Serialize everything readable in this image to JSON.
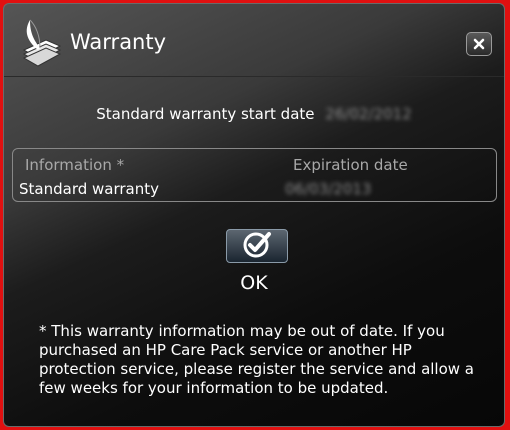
{
  "window": {
    "title": "Warranty",
    "close_icon": "close-icon",
    "app_icon": "warranty-feather-icon"
  },
  "start_date": {
    "label": "Standard warranty start date",
    "value": "26/02/2012"
  },
  "table": {
    "headers": [
      "Information *",
      "Expiration date"
    ],
    "rows": [
      {
        "information": "Standard warranty",
        "expiration": "06/03/2013"
      }
    ]
  },
  "ok_button": {
    "icon": "checkmark-icon",
    "label": "OK"
  },
  "footnote": "* This warranty information may be out of date. If you purchased an HP Care Pack service or another HP protection service, please register the service and allow a few weeks for your information to be updated.",
  "colors": {
    "background_frame": "#e01010",
    "window_dark": "#0d0d0d",
    "header_text": "#a8a8a8",
    "text": "#ffffff"
  }
}
